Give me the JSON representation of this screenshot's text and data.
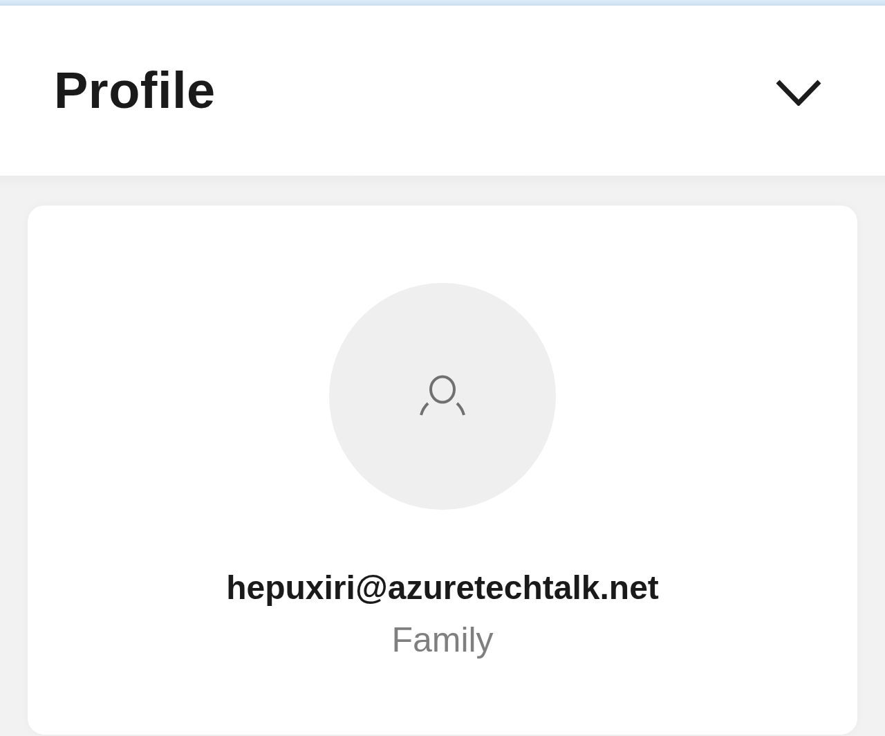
{
  "header": {
    "title": "Profile"
  },
  "profile": {
    "email": "hepuxiri@azuretechtalk.net",
    "role": "Family"
  }
}
